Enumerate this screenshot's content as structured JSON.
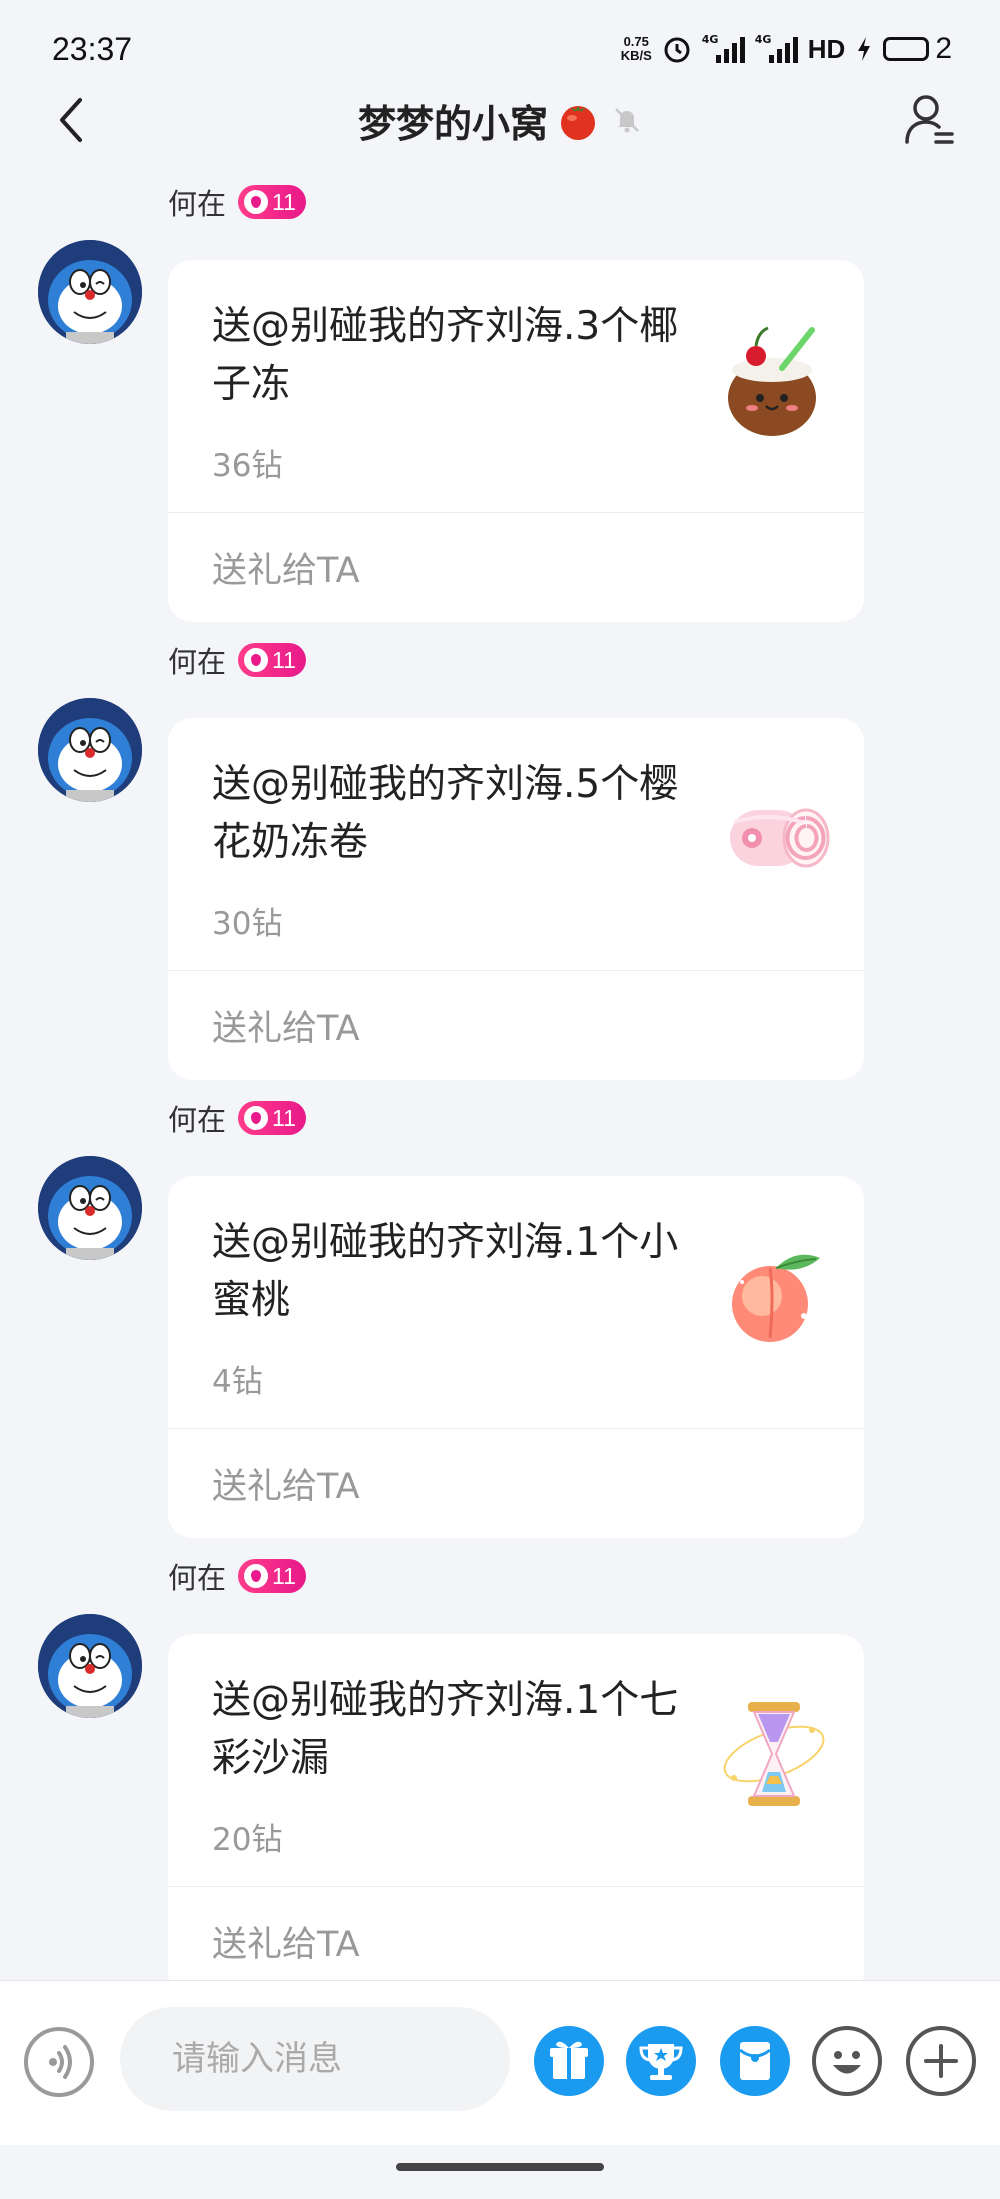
{
  "status_bar": {
    "time": "23:37",
    "net_speed_value": "0.75",
    "net_speed_unit": "KB/S",
    "network_label_1": "4G",
    "network_label_2": "4G",
    "hd_label": "HD",
    "battery_level": "2"
  },
  "header": {
    "title": "梦梦的小窝"
  },
  "messages": [
    {
      "sender": "何在",
      "level": "11",
      "gift_text": "送@别碰我的齐刘海.3个椰子冻",
      "price": "36钻",
      "action": "送礼给TA",
      "gift_icon": "coconut-jelly-icon"
    },
    {
      "sender": "何在",
      "level": "11",
      "gift_text": "送@别碰我的齐刘海.5个樱花奶冻卷",
      "price": "30钻",
      "action": "送礼给TA",
      "gift_icon": "sakura-roll-icon"
    },
    {
      "sender": "何在",
      "level": "11",
      "gift_text": "送@别碰我的齐刘海.1个小蜜桃",
      "price": "4钻",
      "action": "送礼给TA",
      "gift_icon": "peach-icon"
    },
    {
      "sender": "何在",
      "level": "11",
      "gift_text": "送@别碰我的齐刘海.1个七彩沙漏",
      "price": "20钻",
      "action": "送礼给TA",
      "gift_icon": "rainbow-hourglass-icon"
    }
  ],
  "input_bar": {
    "placeholder": "请输入消息"
  },
  "colors": {
    "accent_blue": "#1a9bf0",
    "level_badge_pink": "#e8198a",
    "background": "#f3f5f9"
  }
}
